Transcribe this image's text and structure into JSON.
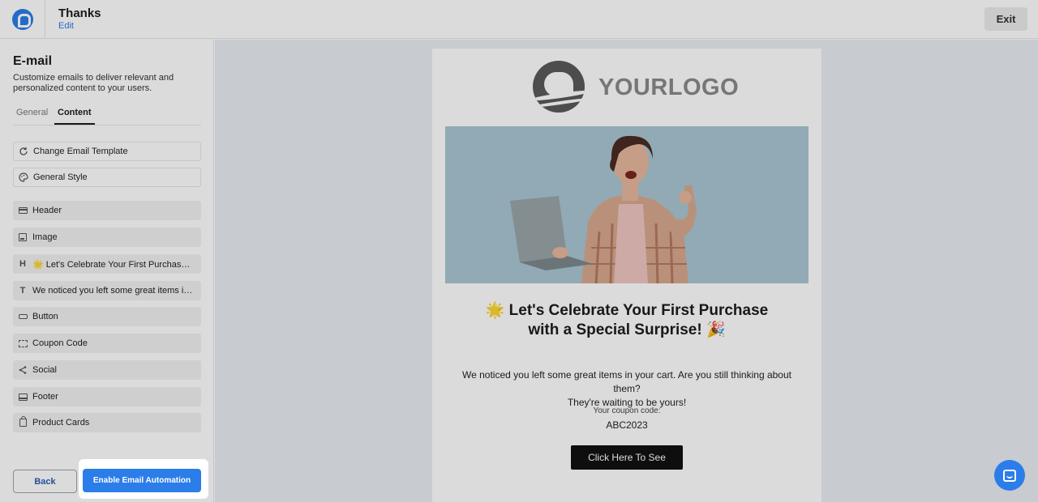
{
  "header": {
    "title": "Thanks",
    "edit_label": "Edit",
    "exit_label": "Exit"
  },
  "sidebar": {
    "title": "E-mail",
    "description": "Customize emails to deliver relevant and personalized content to your users.",
    "tabs": [
      "General",
      "Content"
    ],
    "active_tab": "Content",
    "items": [
      {
        "label": "Change Email Template",
        "icon": "refresh-icon"
      },
      {
        "label": "General Style",
        "icon": "palette-icon"
      },
      {
        "label": "Header",
        "icon": "header-icon"
      },
      {
        "label": "Image",
        "icon": "image-icon"
      },
      {
        "label": "🌟 Let's Celebrate Your First Purchasewith a Special Surprise! 🎉",
        "icon": "heading-icon",
        "icon_text": "H"
      },
      {
        "label": "We noticed you left some great items in your cart. Are you still thinking about them?",
        "icon": "text-icon",
        "icon_text": "T"
      },
      {
        "label": "Button",
        "icon": "button-icon"
      },
      {
        "label": "Coupon Code",
        "icon": "ticket-icon"
      },
      {
        "label": "Social",
        "icon": "share-icon"
      },
      {
        "label": "Footer",
        "icon": "footer-icon"
      },
      {
        "label": "Product Cards",
        "icon": "shopping-bag-icon"
      }
    ],
    "back_label": "Back",
    "enable_label": "Enable Email Automation"
  },
  "email": {
    "logo_text": "YOURLOGO",
    "headline_line1": "🌟 Let's Celebrate Your First Purchase",
    "headline_line2": "with a Special Surprise! 🎉",
    "body_line1": "We noticed you left some great items in your cart. Are you still thinking about them?",
    "body_line2": "They're waiting to be yours!",
    "coupon_label": "Your coupon code:",
    "coupon_code": "ABC2023",
    "cta_label": "Click Here To See"
  },
  "colors": {
    "accent": "#2b7de9",
    "hero_bg": "#a9c6d3",
    "cta_bg": "#111111"
  }
}
